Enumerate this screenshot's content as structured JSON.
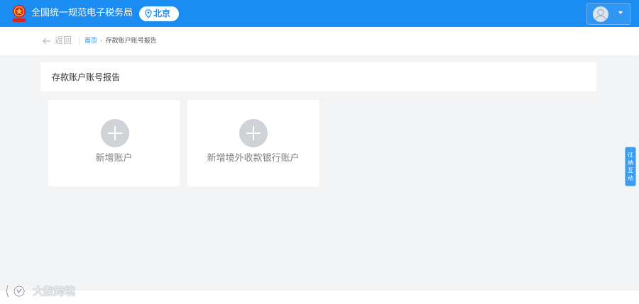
{
  "header": {
    "site_title": "全国统一规范电子税务局",
    "region": "北京",
    "colors": {
      "primary": "#1a8cf2"
    },
    "icons": {
      "logo": "tax-emblem-icon",
      "region": "location-pin-icon",
      "user": "user-avatar-icon",
      "menu": "caret-down-icon"
    }
  },
  "nav": {
    "back_label": "返回",
    "breadcrumb": {
      "home": "首页",
      "separator": "›",
      "current": "存款账户账号报告"
    }
  },
  "panel": {
    "title": "存款账户账号报告"
  },
  "cards": [
    {
      "label": "新增账户",
      "icon": "plus-circle-icon"
    },
    {
      "label": "新增境外收款银行账户",
      "icon": "plus-circle-icon"
    }
  ],
  "side_tab": {
    "label": "征纳互动"
  },
  "watermark": {
    "text": "大數跨境"
  }
}
